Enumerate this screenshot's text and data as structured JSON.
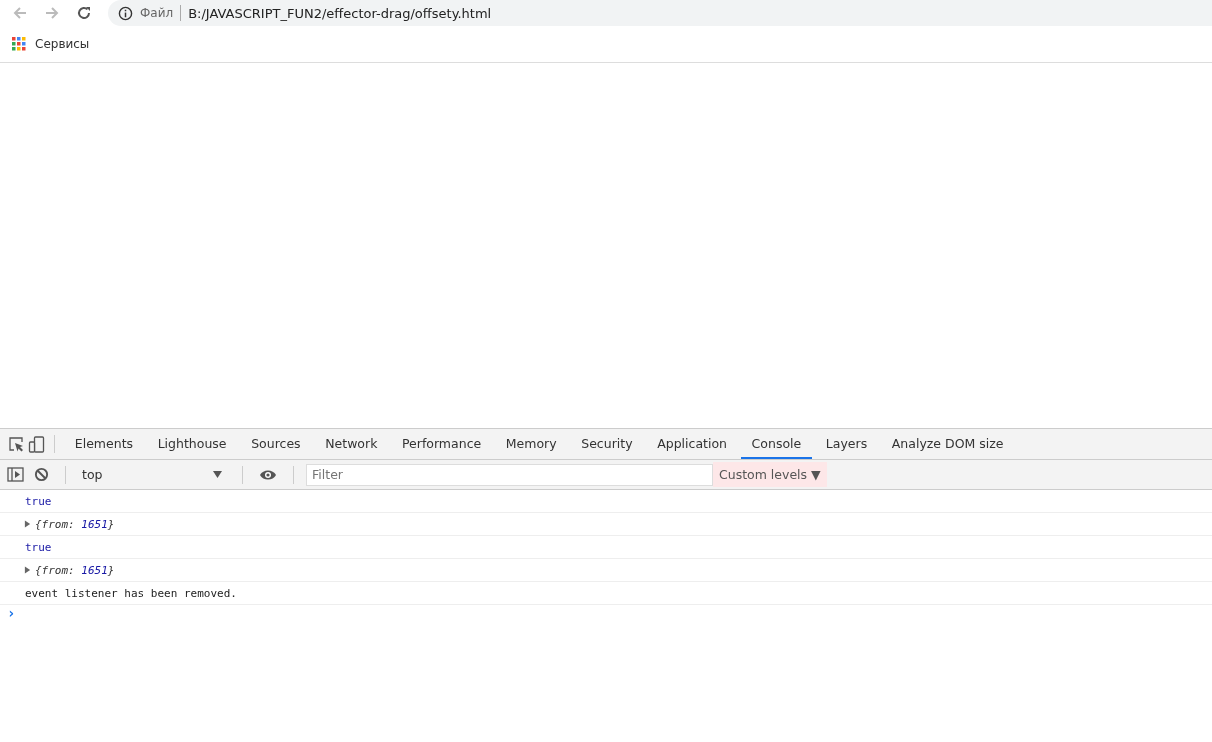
{
  "address_bar": {
    "security_label": "Файл",
    "url": "B:/JAVASCRIPT_FUN2/effector-drag/offsety.html"
  },
  "bookmarks": [
    {
      "label": "Сервисы"
    }
  ],
  "devtools": {
    "tabs": [
      {
        "label": "Elements",
        "selected": false
      },
      {
        "label": "Lighthouse",
        "selected": false
      },
      {
        "label": "Sources",
        "selected": false
      },
      {
        "label": "Network",
        "selected": false
      },
      {
        "label": "Performance",
        "selected": false
      },
      {
        "label": "Memory",
        "selected": false
      },
      {
        "label": "Security",
        "selected": false
      },
      {
        "label": "Application",
        "selected": false
      },
      {
        "label": "Console",
        "selected": true
      },
      {
        "label": "Layers",
        "selected": false
      },
      {
        "label": "Analyze DOM size",
        "selected": false
      }
    ],
    "context": "top",
    "filter": {
      "placeholder": "Filter"
    },
    "levels": "Custom levels",
    "levels_caret": "▼",
    "messages": [
      {
        "kind": "boolean",
        "text": "true"
      },
      {
        "kind": "object",
        "expanded": false,
        "open": "{",
        "key": "from: ",
        "value": "1651",
        "close": "}"
      },
      {
        "kind": "boolean",
        "text": "true"
      },
      {
        "kind": "object",
        "expanded": false,
        "open": "{",
        "key": "from: ",
        "value": "1651",
        "close": "}"
      },
      {
        "kind": "string",
        "text": "event listener has been removed."
      }
    ],
    "prompt": "›"
  }
}
